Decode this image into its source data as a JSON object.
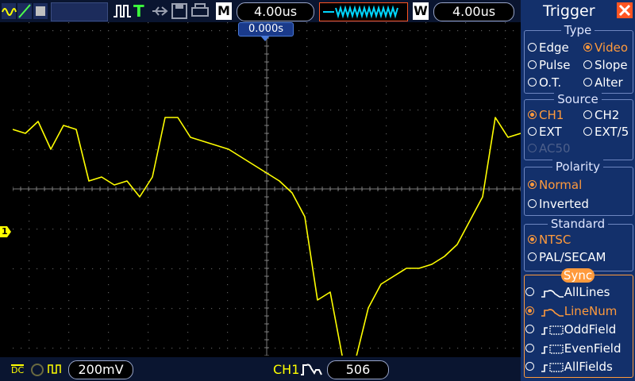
{
  "topbar": {
    "run_state": "T",
    "horizontal_mode": "M",
    "timebase": "4.00us",
    "window_mode": "W",
    "window_timebase": "4.00us"
  },
  "trigger_position": "0.000s",
  "channel_marker": "1",
  "bottombar": {
    "coupling": "DC",
    "volts_div": "200mV",
    "trigger_source": "CH1",
    "trigger_value": "506"
  },
  "panel": {
    "title": "Trigger",
    "type": {
      "label": "Type",
      "options": [
        "Edge",
        "Video",
        "Pulse",
        "Slope",
        "O.T.",
        "Alter"
      ],
      "selected": "Video"
    },
    "source": {
      "label": "Source",
      "options": [
        "CH1",
        "CH2",
        "EXT",
        "EXT/5",
        "AC50"
      ],
      "selected": "CH1"
    },
    "polarity": {
      "label": "Polarity",
      "options": [
        "Normal",
        "Inverted"
      ],
      "selected": "Normal"
    },
    "standard": {
      "label": "Standard",
      "options": [
        "NTSC",
        "PAL/SECAM"
      ],
      "selected": "NTSC"
    },
    "sync": {
      "label": "Sync",
      "options": [
        "AllLines",
        "LineNum",
        "OddField",
        "EvenField",
        "AllFields"
      ],
      "selected": "LineNum"
    }
  },
  "colors": {
    "trace": "#ffff00",
    "selected": "#ff9a3c",
    "panel_bg": "#13306b",
    "topbar_bg": "#0a1530"
  },
  "chart_data": {
    "type": "line",
    "series": [
      {
        "values": [
          1.9,
          1.8,
          2.1,
          1.4,
          2.0,
          1.9,
          0.6,
          0.7,
          0.5,
          0.6,
          0.2,
          0.7,
          2.2,
          2.2,
          1.7,
          1.6,
          1.5,
          1.4,
          1.2,
          1.0,
          0.8,
          0.6,
          0.3,
          -0.3,
          -2.4,
          -2.2,
          -3.9,
          -3.9,
          -2.6,
          -2.0,
          -1.8,
          -1.6,
          -1.6,
          -1.5,
          -1.3,
          -1.0,
          -0.4,
          0.2,
          2.2,
          1.7,
          1.8
        ]
      }
    ]
  }
}
